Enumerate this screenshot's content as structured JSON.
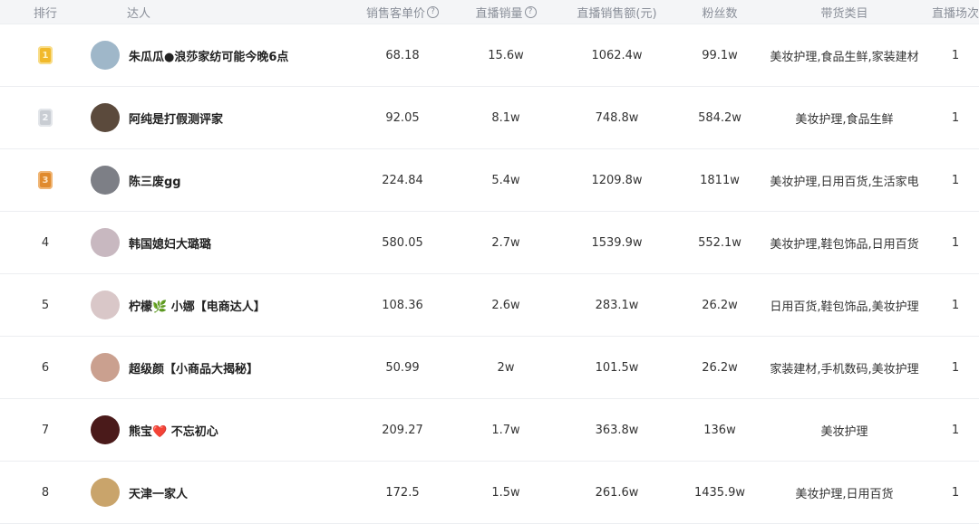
{
  "header": {
    "rank": "排行",
    "streamer": "达人",
    "unit_price": "销售客单价",
    "live_volume": "直播销量",
    "live_amount": "直播销售额(元)",
    "fans": "粉丝数",
    "category": "带货类目",
    "sessions": "直播场次",
    "help_icon": "?"
  },
  "rows": [
    {
      "rank": "1",
      "name": "朱瓜瓜●浪莎家纺可能今晚6点",
      "unit_price": "68.18",
      "live_volume": "15.6w",
      "live_amount": "1062.4w",
      "fans": "99.1w",
      "category": "美妆护理,食品生鲜,家装建材",
      "sessions": "1"
    },
    {
      "rank": "2",
      "name": "阿纯是打假测评家",
      "unit_price": "92.05",
      "live_volume": "8.1w",
      "live_amount": "748.8w",
      "fans": "584.2w",
      "category": "美妆护理,食品生鲜",
      "sessions": "1"
    },
    {
      "rank": "3",
      "name": "陈三废gg",
      "unit_price": "224.84",
      "live_volume": "5.4w",
      "live_amount": "1209.8w",
      "fans": "1811w",
      "category": "美妆护理,日用百货,生活家电",
      "sessions": "1"
    },
    {
      "rank": "4",
      "name": "韩国媳妇大璐璐",
      "unit_price": "580.05",
      "live_volume": "2.7w",
      "live_amount": "1539.9w",
      "fans": "552.1w",
      "category": "美妆护理,鞋包饰品,日用百货",
      "sessions": "1"
    },
    {
      "rank": "5",
      "name": "柠檬🌿 小娜【电商达人】",
      "unit_price": "108.36",
      "live_volume": "2.6w",
      "live_amount": "283.1w",
      "fans": "26.2w",
      "category": "日用百货,鞋包饰品,美妆护理",
      "sessions": "1"
    },
    {
      "rank": "6",
      "name": "超级颜【小商品大揭秘】",
      "unit_price": "50.99",
      "live_volume": "2w",
      "live_amount": "101.5w",
      "fans": "26.2w",
      "category": "家装建材,手机数码,美妆护理",
      "sessions": "1"
    },
    {
      "rank": "7",
      "name": "熊宝❤️ 不忘初心",
      "unit_price": "209.27",
      "live_volume": "1.7w",
      "live_amount": "363.8w",
      "fans": "136w",
      "category": "美妆护理",
      "sessions": "1"
    },
    {
      "rank": "8",
      "name": "天津一家人",
      "unit_price": "172.5",
      "live_volume": "1.5w",
      "live_amount": "261.6w",
      "fans": "1435.9w",
      "category": "美妆护理,日用百货",
      "sessions": "1"
    }
  ],
  "medal_colors": {
    "gold": "#f1b92b",
    "silver": "#c9cdd3",
    "bronze": "#e08a2d"
  },
  "avatar_colors": [
    "#9fb7c9",
    "#5b4a3c",
    "#7d7f86",
    "#c8b8c0",
    "#d9c7c8",
    "#caa08f",
    "#4a1a1a",
    "#c9a46b"
  ]
}
